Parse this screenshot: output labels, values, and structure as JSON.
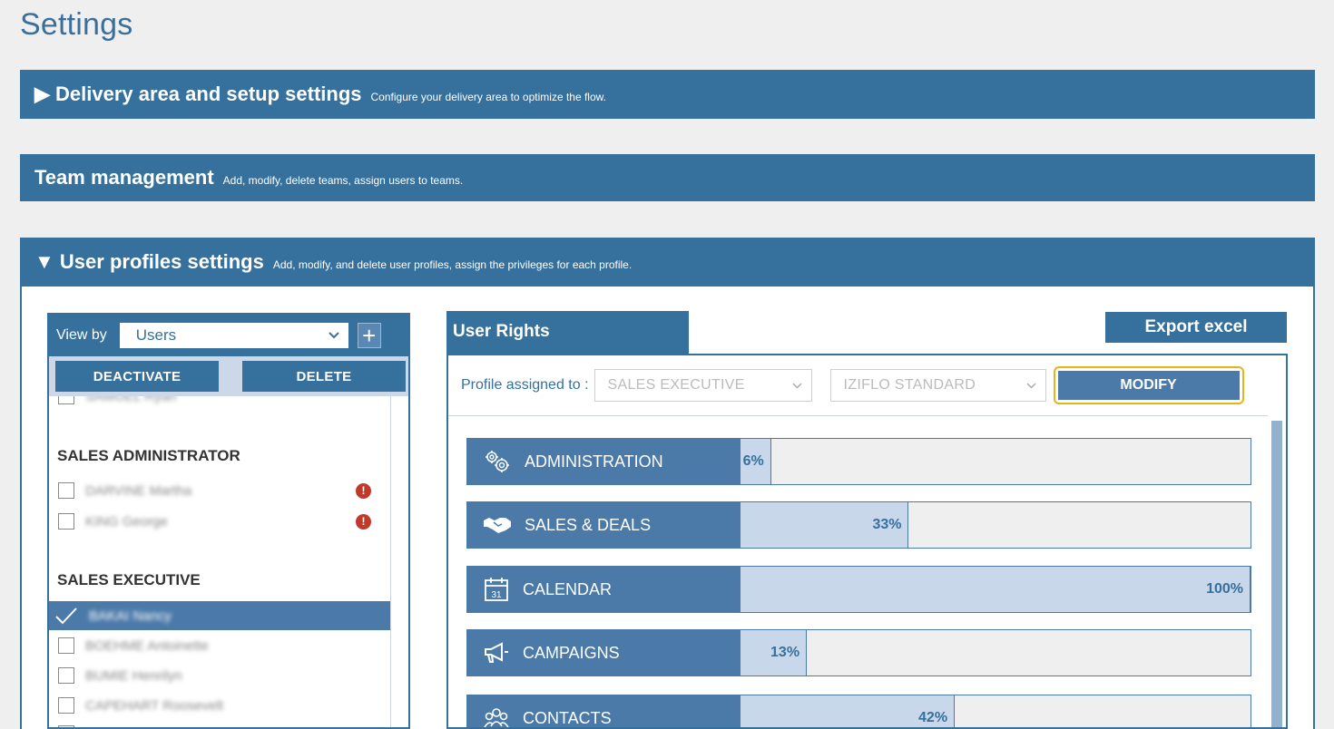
{
  "page": {
    "title": "Settings"
  },
  "sections": {
    "delivery": {
      "title": "Delivery area and setup settings",
      "description": "Configure your delivery area to optimize the flow.",
      "arrow": "▶"
    },
    "team": {
      "title": "Team management",
      "description": "Add, modify, delete teams, assign users to teams."
    },
    "profiles": {
      "title": "User profiles settings",
      "description": "Add, modify, and delete user profiles, assign the privileges for each profile.",
      "arrow": "▼"
    }
  },
  "left_panel": {
    "view_by_label": "View by",
    "view_by_value": "Users",
    "plus_label": "+",
    "deactivate_label": "DEACTIVATE",
    "delete_label": "DELETE",
    "groups": [
      {
        "name": "SALES ADMINISTRATOR",
        "users": [
          {
            "name": "DARVINE Martha",
            "warning": true
          },
          {
            "name": "KING George",
            "warning": true
          }
        ]
      },
      {
        "name": "SALES EXECUTIVE",
        "users": [
          {
            "name": "BAKAI Nancy",
            "selected": true
          },
          {
            "name": "BOEHME Antoinette"
          },
          {
            "name": "BUMIE Henrilyn"
          },
          {
            "name": "CAPEHART Roosevelt"
          }
        ]
      }
    ],
    "truncated_user": "SAMUEL Ryan",
    "warning_glyph": "!"
  },
  "right_panel": {
    "tab_label": "User Rights",
    "export_label": "Export excel",
    "profile_assigned_label": "Profile assigned to :",
    "profile_value": "SALES EXECUTIVE",
    "standard_value": "IZIFLO STANDARD",
    "modify_label": "MODIFY",
    "rights": [
      {
        "label": "ADMINISTRATION",
        "icon": "gears-icon",
        "percent": 6,
        "percent_label": "6%"
      },
      {
        "label": "SALES & DEALS",
        "icon": "handshake-icon",
        "percent": 33,
        "percent_label": "33%"
      },
      {
        "label": "CALENDAR",
        "icon": "calendar-icon",
        "percent": 100,
        "percent_label": "100%"
      },
      {
        "label": "CAMPAIGNS",
        "icon": "megaphone-icon",
        "percent": 13,
        "percent_label": "13%"
      },
      {
        "label": "CONTACTS",
        "icon": "contacts-icon",
        "percent": 42,
        "percent_label": "42%"
      }
    ]
  },
  "colors": {
    "primary": "#36709c",
    "row_label": "#4c7aa8",
    "fill": "#c8d7ea",
    "highlight": "#e8b318",
    "warning": "#c0392b"
  }
}
